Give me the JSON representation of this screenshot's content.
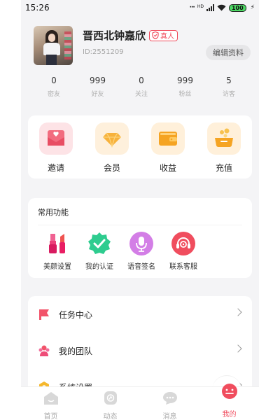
{
  "status": {
    "time": "15:26",
    "network": "HD",
    "battery": "100"
  },
  "profile": {
    "name": "晋西北钟嘉欣",
    "verified_label": "真人",
    "id_text": "ID:2551209",
    "edit_label": "编辑资料"
  },
  "stats": [
    {
      "value": "0",
      "label": "密友"
    },
    {
      "value": "999",
      "label": "好友"
    },
    {
      "value": "0",
      "label": "关注"
    },
    {
      "value": "999",
      "label": "粉丝"
    },
    {
      "value": "5",
      "label": "访客"
    }
  ],
  "wallet": [
    {
      "label": "邀请",
      "icon": "invite-envelope-icon"
    },
    {
      "label": "会员",
      "icon": "vip-diamond-icon"
    },
    {
      "label": "收益",
      "icon": "income-wallet-icon"
    },
    {
      "label": "充值",
      "icon": "recharge-coins-icon"
    }
  ],
  "common": {
    "title": "常用功能",
    "items": [
      {
        "label": "美颜设置",
        "icon": "beauty-lipstick-icon"
      },
      {
        "label": "我的认证",
        "icon": "verified-badge-icon"
      },
      {
        "label": "语音签名",
        "icon": "microphone-icon"
      },
      {
        "label": "联系客服",
        "icon": "headset-icon"
      }
    ]
  },
  "menu": [
    {
      "label": "任务中心",
      "icon": "flag-icon"
    },
    {
      "label": "我的团队",
      "icon": "team-icon"
    },
    {
      "label": "系统设置",
      "icon": "settings-icon"
    }
  ],
  "tabs": [
    {
      "label": "首页",
      "icon": "home-icon"
    },
    {
      "label": "动态",
      "icon": "moments-icon"
    },
    {
      "label": "消息",
      "icon": "message-icon"
    },
    {
      "label": "我的",
      "icon": "profile-face-icon",
      "active": true
    }
  ],
  "colors": {
    "accent": "#f04d5e",
    "background": "#f4f4f6"
  }
}
